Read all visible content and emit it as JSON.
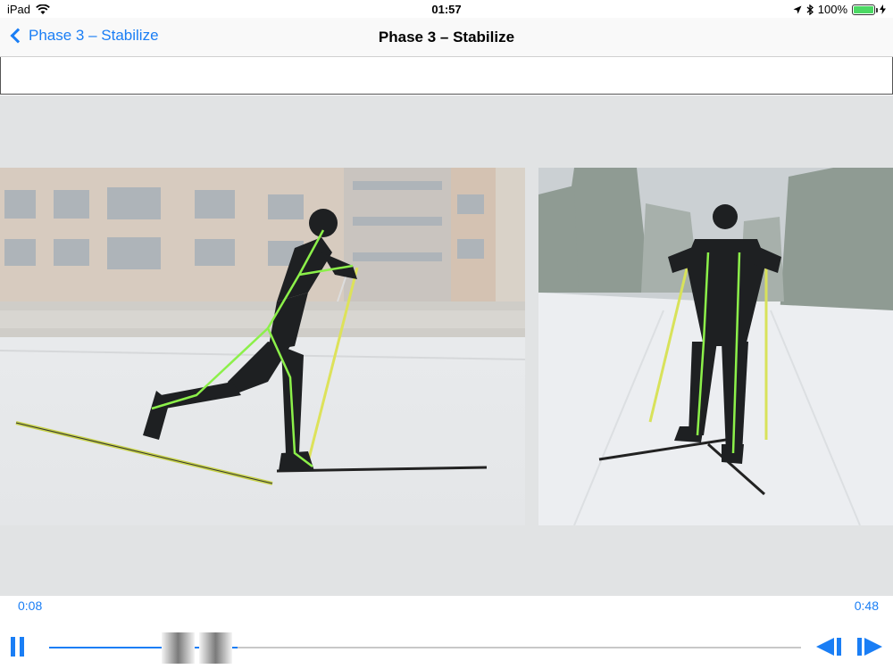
{
  "status_bar": {
    "device": "iPad",
    "time": "01:57",
    "battery": "100%",
    "battery_level": 1.0
  },
  "nav": {
    "back_label": "Phase 3 – Stabilize",
    "title": "Phase 3 – Stabilize"
  },
  "player": {
    "current_time": "0:08",
    "duration": "0:48",
    "progress": 0.167,
    "accent_color": "#1a7ef5"
  },
  "icons": {
    "back": "chevron-left-icon",
    "pause": "pause-icon",
    "step_back": "step-backward-icon",
    "step_forward": "step-forward-icon",
    "wifi": "wifi-icon",
    "location": "location-arrow-icon",
    "bluetooth": "bluetooth-icon",
    "charging": "bolt-icon"
  }
}
